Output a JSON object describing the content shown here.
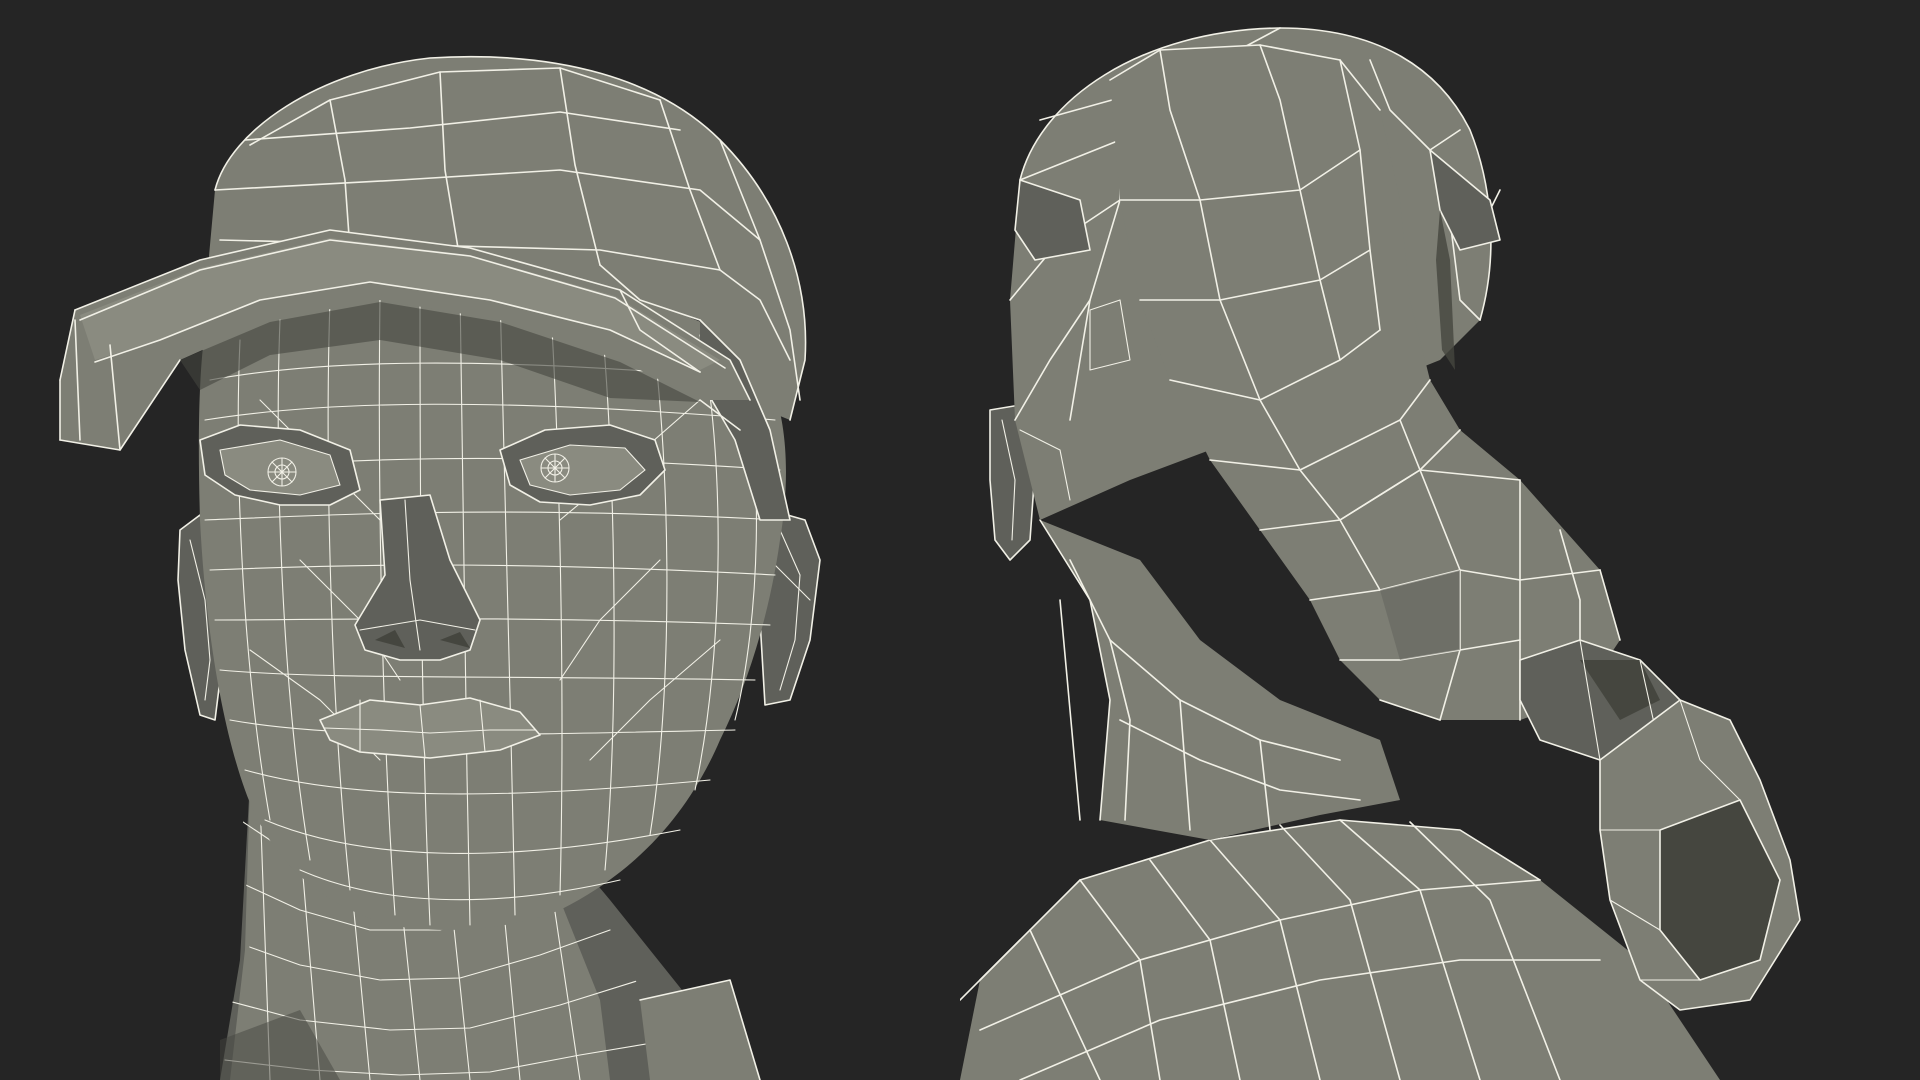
{
  "scene": {
    "background_color": "#252525",
    "mesh_color": "#7d7e74",
    "wire_color": "#f1f0e6",
    "views": [
      {
        "name": "front-view",
        "subject": "head-with-cap"
      },
      {
        "name": "back-view",
        "subject": "head-with-cap-and-ponytail"
      }
    ]
  }
}
